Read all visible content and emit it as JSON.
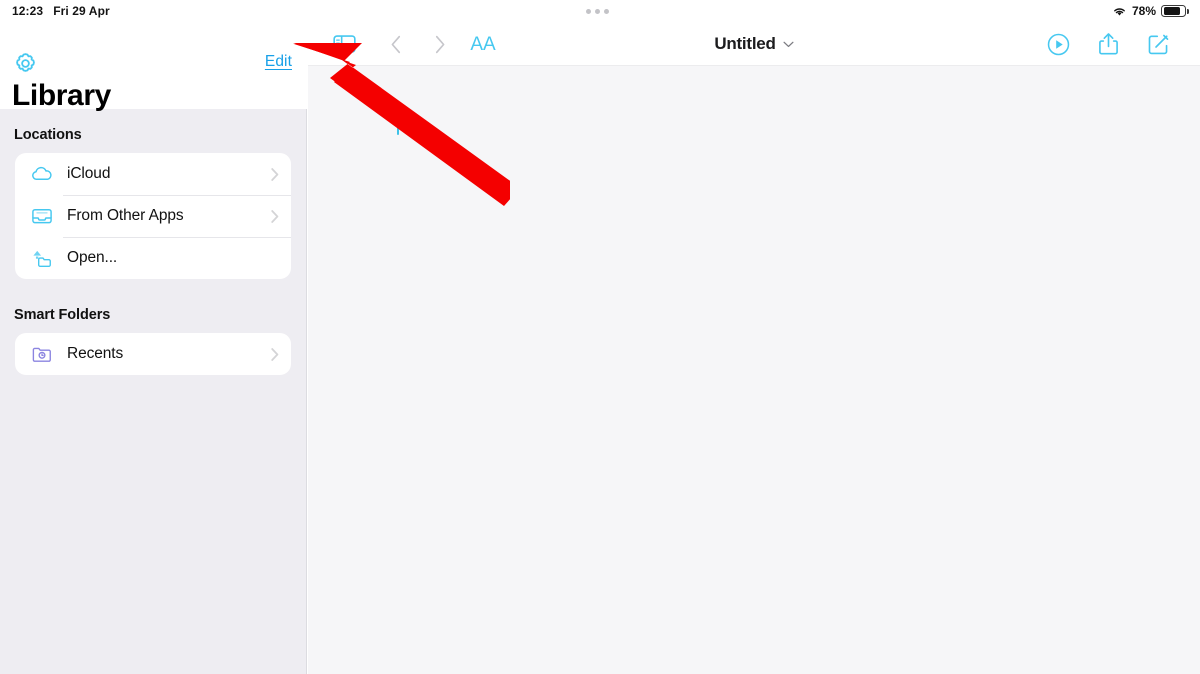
{
  "status_bar": {
    "time": "12:23",
    "date": "Fri 29 Apr",
    "battery_percent": "78%",
    "wifi_icon": "wifi-icon",
    "battery_icon": "battery-icon",
    "battery_level": 78
  },
  "multitask_handle": {
    "icon": "three-dots-handle-icon"
  },
  "sidebar": {
    "settings_icon": "gear-icon",
    "edit_label": "Edit",
    "title": "Library",
    "sections": [
      {
        "label": "Locations",
        "items": [
          {
            "label": "iCloud",
            "icon": "cloud-icon",
            "icon_color": "#46c8f0",
            "accessory": "chevron-right-icon"
          },
          {
            "label": "From Other Apps",
            "icon": "tray-icon",
            "icon_color": "#46c8f0",
            "accessory": "chevron-right-icon"
          },
          {
            "label": "Open...",
            "icon": "folder-open-icon",
            "icon_color": "#46c8f0",
            "accessory": ""
          }
        ]
      },
      {
        "label": "Smart Folders",
        "items": [
          {
            "label": "Recents",
            "icon": "folder-clock-icon",
            "icon_color": "#8b84e0",
            "accessory": "chevron-right-icon"
          }
        ]
      }
    ]
  },
  "toolbar": {
    "sidebar_toggle_icon": "sidebar-toggle-icon",
    "back_icon": "chevron-left-icon",
    "forward_icon": "chevron-right-icon",
    "text_size_label": "AA",
    "text_size_icon": "text-size-icon",
    "document_title": "Untitled",
    "document_title_chevron": "chevron-down-icon",
    "play_icon": "play-circle-icon",
    "share_icon": "share-icon",
    "compose_icon": "compose-icon"
  },
  "document": {
    "caret": "text-caret",
    "body_text": ""
  },
  "annotation": {
    "arrow_color": "#f40000",
    "arrow_icon": "red-arrow-pointer",
    "points_to": "Edit"
  },
  "colors": {
    "accent_blue": "#18a0e8",
    "icon_cyan": "#46c8f0",
    "purple": "#8b84e0",
    "sidebar_bg": "#eeedf2",
    "canvas_bg": "#f6f6f8",
    "annotation_red": "#f40000"
  }
}
